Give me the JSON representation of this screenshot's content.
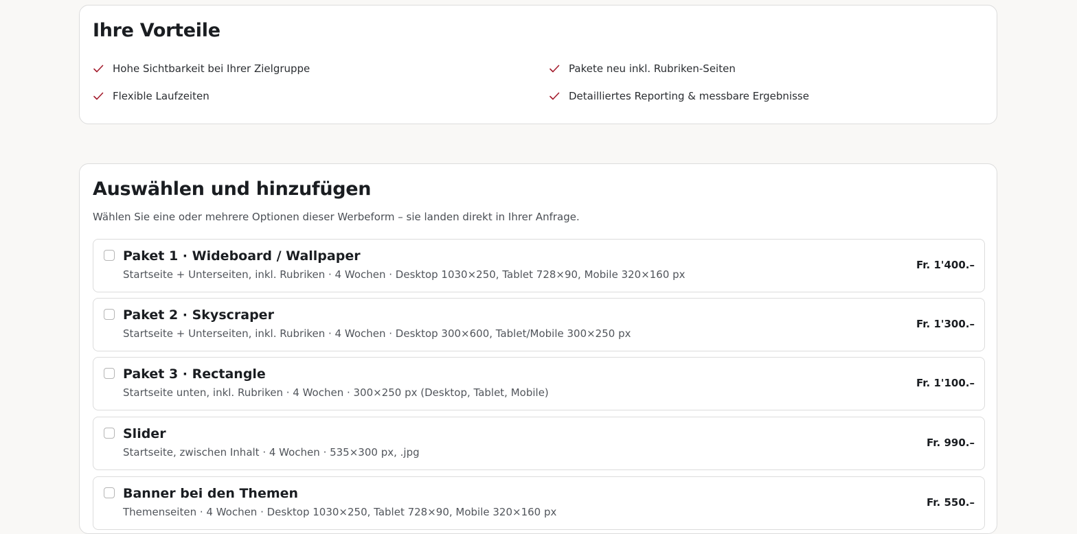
{
  "advantages": {
    "title": "Ihre Vorteile",
    "items": [
      "Hohe Sichtbarkeit bei Ihrer Zielgruppe",
      "Pakete neu inkl. Rubriken-Seiten",
      "Flexible Laufzeiten",
      "Detailliertes Reporting & messbare Ergebnisse"
    ],
    "check_color": "#a31b2c"
  },
  "select": {
    "title": "Auswählen und hinzufügen",
    "intro": "Wählen Sie eine oder mehrere Optionen dieser Werbeform – sie landen direkt in Ihrer Anfrage.",
    "options": [
      {
        "title": "Paket 1 · Wideboard / Wallpaper",
        "desc": "Startseite + Unterseiten, inkl. Rubriken · 4 Wochen · Desktop 1030×250, Tablet 728×90, Mobile 320×160 px",
        "price": "Fr. 1'400.–",
        "checked": false
      },
      {
        "title": "Paket 2 · Skyscraper",
        "desc": "Startseite + Unterseiten, inkl. Rubriken · 4 Wochen · Desktop 300×600, Tablet/Mobile 300×250 px",
        "price": "Fr. 1'300.–",
        "checked": false
      },
      {
        "title": "Paket 3 · Rectangle",
        "desc": "Startseite unten, inkl. Rubriken · 4 Wochen · 300×250 px (Desktop, Tablet, Mobile)",
        "price": "Fr. 1'100.–",
        "checked": false
      },
      {
        "title": "Slider",
        "desc": "Startseite, zwischen Inhalt · 4 Wochen · 535×300 px, .jpg",
        "price": "Fr. 990.–",
        "checked": false
      },
      {
        "title": "Banner bei den Themen",
        "desc": "Themenseiten · 4 Wochen · Desktop 1030×250, Tablet 728×90, Mobile 320×160 px",
        "price": "Fr. 550.–",
        "checked": false
      }
    ]
  }
}
